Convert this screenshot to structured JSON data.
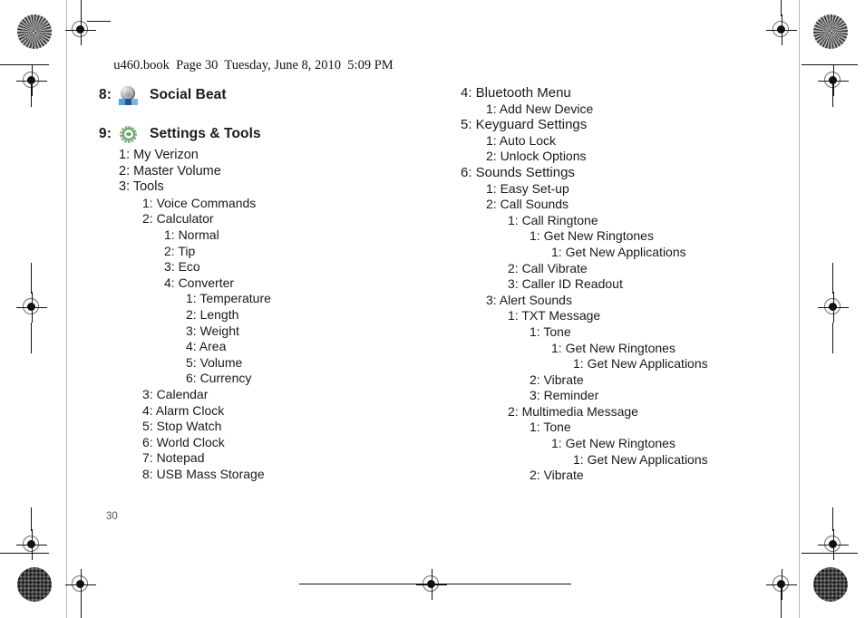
{
  "header": {
    "text": "u460.book  Page 30  Tuesday, June 8, 2010  5:09 PM"
  },
  "page_number": "30",
  "colors": {
    "text": "#1a1a1a",
    "gear_accent": "#4dba4b",
    "rule": "#b9b9b9",
    "page_number": "#555555"
  },
  "left_column": {
    "sections": [
      {
        "number": "8:",
        "label": "Social Beat",
        "icon": "social-beat-icon",
        "items": []
      },
      {
        "number": "9:",
        "label": "Settings & Tools",
        "icon": "settings-gear-icon",
        "items": [
          {
            "level": 1,
            "text": "1: My Verizon"
          },
          {
            "level": 1,
            "text": "2: Master Volume"
          },
          {
            "level": 1,
            "text": "3: Tools"
          },
          {
            "level": 2,
            "text": "1: Voice Commands"
          },
          {
            "level": 2,
            "text": "2: Calculator"
          },
          {
            "level": 3,
            "text": "1: Normal"
          },
          {
            "level": 3,
            "text": "2: Tip"
          },
          {
            "level": 3,
            "text": "3: Eco"
          },
          {
            "level": 3,
            "text": "4: Converter"
          },
          {
            "level": 4,
            "text": "1: Temperature"
          },
          {
            "level": 4,
            "text": "2: Length"
          },
          {
            "level": 4,
            "text": "3: Weight"
          },
          {
            "level": 4,
            "text": "4: Area"
          },
          {
            "level": 4,
            "text": "5: Volume"
          },
          {
            "level": 4,
            "text": "6: Currency"
          },
          {
            "level": 2,
            "text": "3: Calendar"
          },
          {
            "level": 2,
            "text": "4: Alarm Clock"
          },
          {
            "level": 2,
            "text": "5: Stop Watch"
          },
          {
            "level": 2,
            "text": "6: World Clock"
          },
          {
            "level": 2,
            "text": "7: Notepad"
          },
          {
            "level": 2,
            "text": "8: USB Mass Storage"
          }
        ]
      }
    ]
  },
  "right_column": {
    "items": [
      {
        "level": 1,
        "text": "4: Bluetooth Menu"
      },
      {
        "level": 2,
        "text": "1: Add New Device"
      },
      {
        "level": 1,
        "text": "5: Keyguard Settings"
      },
      {
        "level": 2,
        "text": "1: Auto Lock"
      },
      {
        "level": 2,
        "text": "2: Unlock Options"
      },
      {
        "level": 1,
        "text": "6: Sounds Settings"
      },
      {
        "level": 2,
        "text": "1: Easy Set-up"
      },
      {
        "level": 2,
        "text": "2: Call Sounds"
      },
      {
        "level": 3,
        "text": "1: Call Ringtone"
      },
      {
        "level": 4,
        "text": "1: Get New Ringtones"
      },
      {
        "level": 5,
        "text": "1: Get New Applications"
      },
      {
        "level": 3,
        "text": "2: Call Vibrate"
      },
      {
        "level": 3,
        "text": "3: Caller ID Readout"
      },
      {
        "level": 2,
        "text": "3: Alert Sounds"
      },
      {
        "level": 3,
        "text": "1: TXT Message"
      },
      {
        "level": 4,
        "text": "1: Tone"
      },
      {
        "level": 5,
        "text": "1: Get New Ringtones"
      },
      {
        "level": 6,
        "text": "1: Get New Applications"
      },
      {
        "level": 4,
        "text": "2: Vibrate"
      },
      {
        "level": 4,
        "text": "3: Reminder"
      },
      {
        "level": 3,
        "text": "2: Multimedia Message"
      },
      {
        "level": 4,
        "text": "1: Tone"
      },
      {
        "level": 5,
        "text": "1: Get New Ringtones"
      },
      {
        "level": 6,
        "text": "1: Get New Applications"
      },
      {
        "level": 4,
        "text": "2: Vibrate"
      }
    ]
  }
}
